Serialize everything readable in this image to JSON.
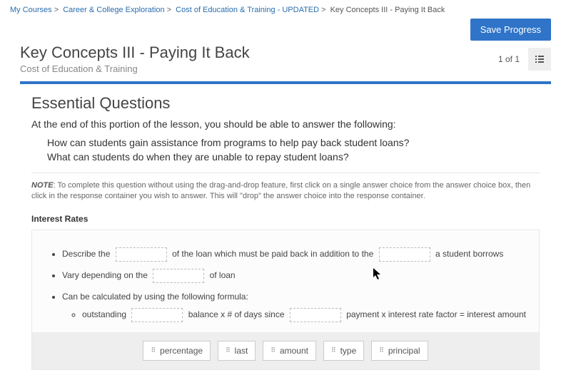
{
  "breadcrumb": {
    "items": [
      "My Courses",
      "Career & College Exploration",
      "Cost of Education & Training - UPDATED"
    ],
    "current": "Key Concepts III - Paying It Back"
  },
  "buttons": {
    "save": "Save Progress"
  },
  "title": {
    "main": "Key Concepts III - Paying It Back",
    "sub": "Cost of Education & Training"
  },
  "pager": "1 of 1",
  "essential": {
    "heading": "Essential Questions",
    "lead": "At the end of this portion of the lesson, you should be able to answer the following:",
    "q1": "How can students gain assistance from programs to help pay back student loans?",
    "q2": "What can students do when they are unable to repay student loans?"
  },
  "note": {
    "label": "NOTE",
    "text": ": To complete this question without using the drag-and-drop feature, first click on a single answer choice from the answer choice box, then click in the response container you wish to answer. This will \"drop\" the answer choice into the response container."
  },
  "section": {
    "title": "Interest Rates"
  },
  "bullets": {
    "b1a": "Describe the",
    "b1b": "of the loan which must be paid back in addition to the",
    "b1c": "a student borrows",
    "b2a": "Vary depending on the",
    "b2b": "of loan",
    "b3": "Can be calculated by using the following formula:",
    "b3sub_a": "outstanding",
    "b3sub_b": "balance x # of days since",
    "b3sub_c": "payment x interest rate factor = interest amount"
  },
  "choices": [
    "percentage",
    "last",
    "amount",
    "type",
    "principal"
  ]
}
